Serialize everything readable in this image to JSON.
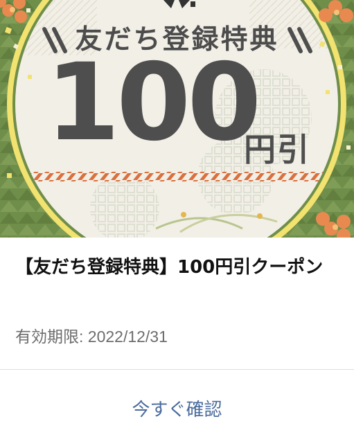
{
  "banner": {
    "heading": "友だち登録特典",
    "amount": "100",
    "unit": "円引",
    "colors": {
      "frame_green": "#6f8e4a",
      "ring_yellow": "#f2e26f",
      "circle_fill": "#f2efe7",
      "text_dark": "#4f4e4e",
      "stripe_orange": "#d9703d",
      "flower_orange": "#e88a4f"
    }
  },
  "coupon": {
    "title": "【友だち登録特典】100円引クーポン",
    "expiry_label": "有効期限:",
    "expiry_date": "2022/12/31"
  },
  "action": {
    "confirm_label": "今すぐ確認",
    "color": "#4a6b9c"
  }
}
